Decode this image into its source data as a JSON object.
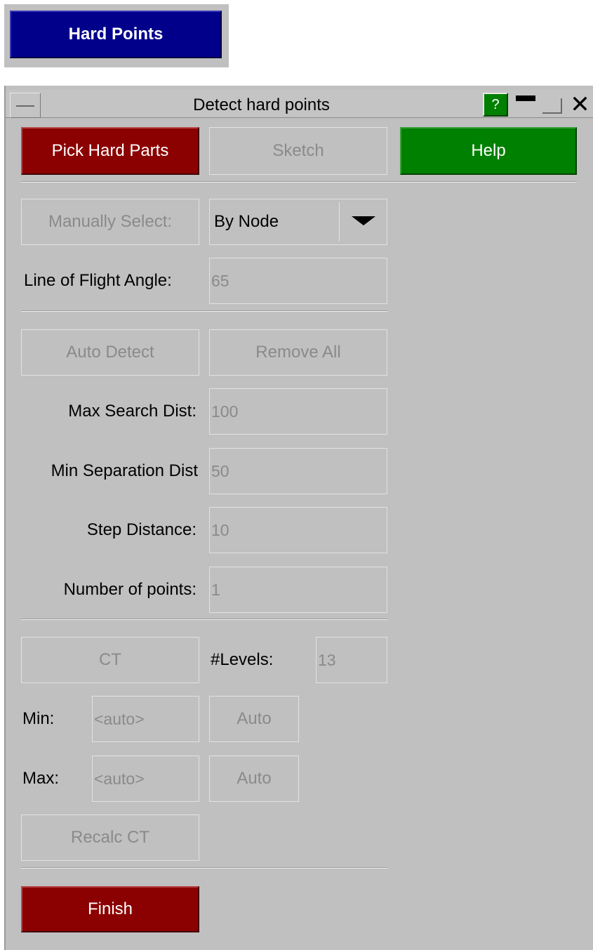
{
  "top_button": {
    "label": "Hard Points"
  },
  "window": {
    "title": "Detect hard points",
    "help_label": "?",
    "close_glyph": "✕"
  },
  "toolbar": {
    "pick_hard_parts": "Pick Hard Parts",
    "sketch": "Sketch",
    "help": "Help"
  },
  "manual": {
    "button": "Manually Select:",
    "select_value": "By Node",
    "angle_label": "Line of Flight Angle:",
    "angle_value": "65"
  },
  "auto": {
    "auto_detect": "Auto Detect",
    "remove_all": "Remove All",
    "fields": [
      {
        "label": "Max Search Dist:",
        "value": "100"
      },
      {
        "label": "Min Separation Dist",
        "value": "50"
      },
      {
        "label": "Step Distance:",
        "value": "10"
      },
      {
        "label": "Number of points:",
        "value": "1"
      }
    ]
  },
  "ct": {
    "button": "CT",
    "levels_label": "#Levels:",
    "levels_value": "13",
    "min_label": "Min:",
    "min_value": "<auto>",
    "min_auto": "Auto",
    "max_label": "Max:",
    "max_value": "<auto>",
    "max_auto": "Auto",
    "recalc": "Recalc CT"
  },
  "footer": {
    "finish": "Finish"
  },
  "colors": {
    "panel_bg": "#c0c0c0",
    "top_button_bg": "#00008b",
    "danger_button_bg": "#8b0000",
    "help_button_bg": "#008000",
    "disabled_text": "#8a8a8a"
  }
}
